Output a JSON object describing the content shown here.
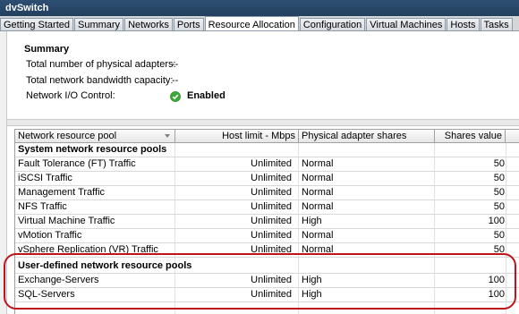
{
  "window": {
    "title": "dvSwitch"
  },
  "tabs": [
    {
      "label": "Getting Started"
    },
    {
      "label": "Summary"
    },
    {
      "label": "Networks"
    },
    {
      "label": "Ports"
    },
    {
      "label": "Resource Allocation"
    },
    {
      "label": "Configuration"
    },
    {
      "label": "Virtual Machines"
    },
    {
      "label": "Hosts"
    },
    {
      "label": "Tasks"
    }
  ],
  "summary": {
    "title": "Summary",
    "physical_adapters_label": "Total number of physical adapters:",
    "physical_adapters_value": "--",
    "bandwidth_label": "Total network bandwidth capacity:",
    "bandwidth_value": "--",
    "nioc_label": "Network I/O Control:",
    "nioc_value": "Enabled"
  },
  "grid": {
    "columns": [
      "Network resource pool",
      "Host limit - Mbps",
      "Physical adapter shares",
      "Shares value"
    ],
    "system_group_label": "System network resource pools",
    "system_rows": [
      {
        "name": "Fault Tolerance (FT) Traffic",
        "limit": "Unlimited",
        "shares": "Normal",
        "value": "50"
      },
      {
        "name": "iSCSI Traffic",
        "limit": "Unlimited",
        "shares": "Normal",
        "value": "50"
      },
      {
        "name": "Management Traffic",
        "limit": "Unlimited",
        "shares": "Normal",
        "value": "50"
      },
      {
        "name": "NFS Traffic",
        "limit": "Unlimited",
        "shares": "Normal",
        "value": "50"
      },
      {
        "name": "Virtual Machine Traffic",
        "limit": "Unlimited",
        "shares": "High",
        "value": "100"
      },
      {
        "name": "vMotion Traffic",
        "limit": "Unlimited",
        "shares": "Normal",
        "value": "50"
      },
      {
        "name": "vSphere Replication (VR) Traffic",
        "limit": "Unlimited",
        "shares": "Normal",
        "value": "50"
      }
    ],
    "user_group_label": "User-defined network resource pools",
    "user_rows": [
      {
        "name": "Exchange-Servers",
        "limit": "Unlimited",
        "shares": "High",
        "value": "100"
      },
      {
        "name": "SQL-Servers",
        "limit": "Unlimited",
        "shares": "High",
        "value": "100"
      }
    ]
  },
  "colors": {
    "title_bar": "#22405f",
    "highlight_border": "#c0141b",
    "enabled_icon": "#3aa935"
  },
  "icons": {
    "nioc_status": "green-check-circle-icon"
  }
}
